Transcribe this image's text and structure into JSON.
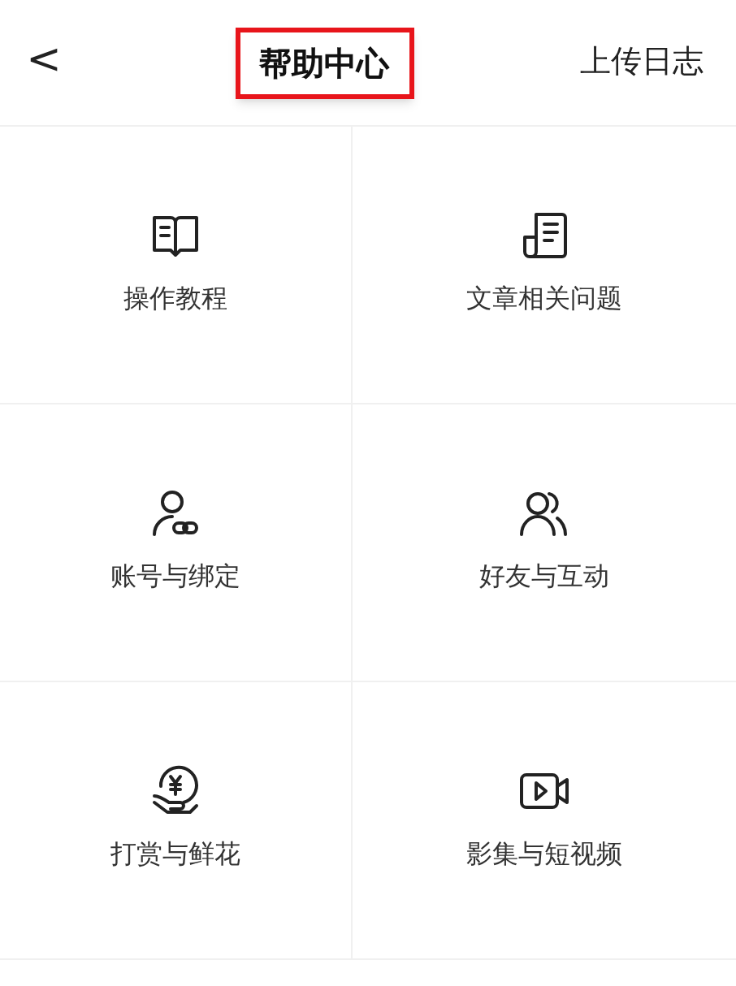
{
  "header": {
    "back": "<",
    "title": "帮助中心",
    "title_highlighted": true,
    "action": "上传日志"
  },
  "topics": [
    {
      "kind": "book",
      "label": "操作教程"
    },
    {
      "kind": "document",
      "label": "文章相关问题"
    },
    {
      "kind": "account-link",
      "label": "账号与绑定"
    },
    {
      "kind": "people",
      "label": "好友与互动"
    },
    {
      "kind": "coin-hand",
      "label": "打赏与鲜花"
    },
    {
      "kind": "video",
      "label": "影集与短视频"
    }
  ]
}
